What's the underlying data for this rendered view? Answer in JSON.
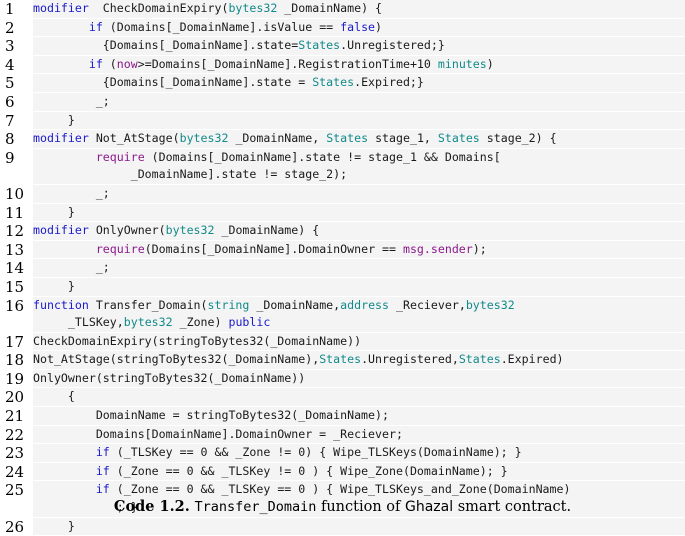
{
  "code_listing": {
    "colors": {
      "keyword": "#1a1acc",
      "type": "#128a8a",
      "builtin": "#8b1a8b",
      "background": "#f4f4f4"
    },
    "lines": [
      {
        "n": "1",
        "segments": [
          [
            "k",
            "modifier"
          ],
          [
            "",
            "  CheckDomainExpiry("
          ],
          [
            "t",
            "bytes32"
          ],
          [
            "",
            " _DomainName) {"
          ]
        ]
      },
      {
        "n": "2",
        "segments": [
          [
            "",
            "        "
          ],
          [
            "k",
            "if"
          ],
          [
            "",
            " (Domains[_DomainName].isValue == "
          ],
          [
            "k",
            "false"
          ],
          [
            "",
            ")"
          ]
        ]
      },
      {
        "n": "3",
        "segments": [
          [
            "",
            "          {Domains[_DomainName].state="
          ],
          [
            "t",
            "States"
          ],
          [
            "",
            ".Unregistered;}"
          ]
        ]
      },
      {
        "n": "4",
        "segments": [
          [
            "",
            "        "
          ],
          [
            "k",
            "if"
          ],
          [
            "",
            " ("
          ],
          [
            "p",
            "now"
          ],
          [
            "",
            ">=Domains[_DomainName].RegistrationTime+10 "
          ],
          [
            "t",
            "minutes"
          ],
          [
            "",
            ")"
          ]
        ]
      },
      {
        "n": "5",
        "segments": [
          [
            "",
            "          {Domains[_DomainName].state = "
          ],
          [
            "t",
            "States"
          ],
          [
            "",
            ".Expired;}"
          ]
        ]
      },
      {
        "n": "6",
        "segments": [
          [
            "",
            "         _;"
          ]
        ]
      },
      {
        "n": "7",
        "segments": [
          [
            "",
            "     }"
          ]
        ]
      },
      {
        "n": "8",
        "segments": [
          [
            "k",
            "modifier"
          ],
          [
            "",
            " Not_AtStage("
          ],
          [
            "t",
            "bytes32"
          ],
          [
            "",
            " _DomainName, "
          ],
          [
            "t",
            "States"
          ],
          [
            "",
            " stage_1, "
          ],
          [
            "t",
            "States"
          ],
          [
            "",
            " stage_2) {"
          ]
        ]
      },
      {
        "n": "9",
        "segments": [
          [
            "",
            "         "
          ],
          [
            "p",
            "require"
          ],
          [
            "",
            " (Domains[_DomainName].state != stage_1 && Domains[\n              _DomainName].state != stage_2);"
          ]
        ]
      },
      {
        "n": "10",
        "segments": [
          [
            "",
            "         _;"
          ]
        ]
      },
      {
        "n": "11",
        "segments": [
          [
            "",
            "     }"
          ]
        ]
      },
      {
        "n": "12",
        "segments": [
          [
            "k",
            "modifier"
          ],
          [
            "",
            " OnlyOwner("
          ],
          [
            "t",
            "bytes32"
          ],
          [
            "",
            " _DomainName) {"
          ]
        ]
      },
      {
        "n": "13",
        "segments": [
          [
            "",
            "         "
          ],
          [
            "p",
            "require"
          ],
          [
            "",
            "(Domains[_DomainName].DomainOwner == "
          ],
          [
            "p",
            "msg.sender"
          ],
          [
            "",
            ");"
          ]
        ]
      },
      {
        "n": "14",
        "segments": [
          [
            "",
            "         _;"
          ]
        ]
      },
      {
        "n": "15",
        "segments": [
          [
            "",
            "     }"
          ]
        ]
      },
      {
        "n": "16",
        "segments": [
          [
            "k",
            "function"
          ],
          [
            "",
            " Transfer_Domain("
          ],
          [
            "t",
            "string"
          ],
          [
            "",
            " _DomainName,"
          ],
          [
            "t",
            "address"
          ],
          [
            "",
            " _Reciever,"
          ],
          [
            "t",
            "bytes32"
          ],
          [
            "",
            "\n     _TLSKey,"
          ],
          [
            "t",
            "bytes32"
          ],
          [
            "",
            " _Zone) "
          ],
          [
            "k",
            "public"
          ]
        ]
      },
      {
        "n": "17",
        "segments": [
          [
            "",
            "CheckDomainExpiry(stringToBytes32(_DomainName))"
          ]
        ]
      },
      {
        "n": "18",
        "segments": [
          [
            "",
            "Not_AtStage(stringToBytes32(_DomainName),"
          ],
          [
            "t",
            "States"
          ],
          [
            "",
            ".Unregistered,"
          ],
          [
            "t",
            "States"
          ],
          [
            "",
            ".Expired)"
          ]
        ]
      },
      {
        "n": "19",
        "segments": [
          [
            "",
            "OnlyOwner(stringToBytes32(_DomainName))"
          ]
        ]
      },
      {
        "n": "20",
        "segments": [
          [
            "",
            "     {"
          ]
        ]
      },
      {
        "n": "21",
        "segments": [
          [
            "",
            "         DomainName = stringToBytes32(_DomainName);"
          ]
        ]
      },
      {
        "n": "22",
        "segments": [
          [
            "",
            "         Domains[DomainName].DomainOwner = _Reciever;"
          ]
        ]
      },
      {
        "n": "23",
        "segments": [
          [
            "",
            "         "
          ],
          [
            "k",
            "if"
          ],
          [
            "",
            " (_TLSKey == 0 && _Zone != 0) { Wipe_TLSKeys(DomainName); }"
          ]
        ]
      },
      {
        "n": "24",
        "segments": [
          [
            "",
            "         "
          ],
          [
            "k",
            "if"
          ],
          [
            "",
            " (_Zone == 0 && _TLSKey != 0 ) { Wipe_Zone(DomainName); }"
          ]
        ]
      },
      {
        "n": "25",
        "segments": [
          [
            "",
            "         "
          ],
          [
            "k",
            "if"
          ],
          [
            "",
            " (_Zone == 0 && _TLSKey == 0 ) { Wipe_TLSKeys_and_Zone(DomainName)\n            ; }"
          ]
        ]
      },
      {
        "n": "26",
        "segments": [
          [
            "",
            "     }"
          ]
        ]
      }
    ]
  },
  "caption": {
    "label": "Code 1.2.",
    "function_name": "Transfer_Domain",
    "text_mid": " function of ",
    "contract_name": "Ghazal",
    "text_end": " smart contract."
  }
}
